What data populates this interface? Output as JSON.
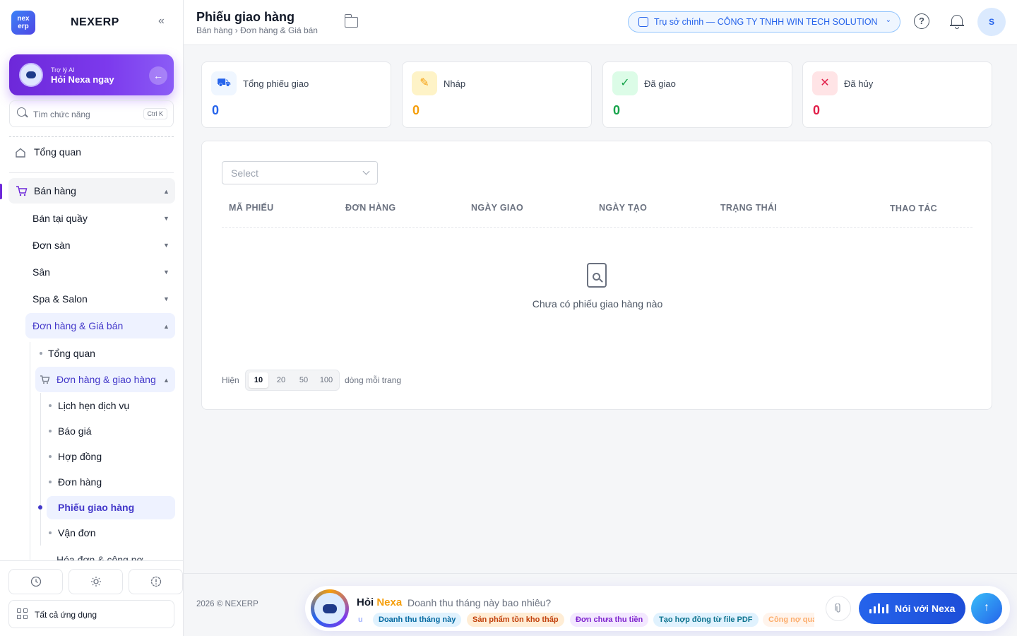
{
  "app": {
    "brand": "NEXERP",
    "logo_text": "nex erp",
    "collapse_icon": "«"
  },
  "ai_card": {
    "small": "Trợ lý AI",
    "title": "Hỏi Nexa ngay",
    "arrow": "←"
  },
  "search": {
    "placeholder": "Tìm chức năng",
    "shortcut": "Ctrl K"
  },
  "sidebar": {
    "overview": "Tổng quan",
    "sales": "Bán hàng",
    "items": [
      "Bán tại quầy",
      "Đơn sàn",
      "Sân",
      "Spa & Salon",
      "Đơn hàng & Giá bán"
    ],
    "sub_overview": "Tổng quan",
    "sub_group": "Đơn hàng & giao hàng",
    "leaves": [
      "Lịch hẹn dịch vụ",
      "Báo giá",
      "Hợp đồng",
      "Đơn hàng",
      "Phiếu giao hàng",
      "Vận đơn"
    ],
    "next_group": "Hóa đơn & công nợ",
    "all_apps": "Tất cả ứng dụng"
  },
  "header": {
    "title": "Phiếu giao hàng",
    "breadcrumb": "Bán hàng › Đơn hàng & Giá bán",
    "branch": "Trụ sở chính — CÔNG TY TNHH WIN TECH SOLUTION",
    "help": "?",
    "user_initial": "S"
  },
  "stats": [
    {
      "label": "Tổng phiếu giao",
      "value": "0",
      "color": "#2563eb",
      "bg": "#eff6ff",
      "icon": "truck-icon",
      "glyph": "⛟"
    },
    {
      "label": "Nháp",
      "value": "0",
      "color": "#f59e0b",
      "bg": "#fef3c7",
      "icon": "edit-icon",
      "glyph": "✎"
    },
    {
      "label": "Đã giao",
      "value": "0",
      "color": "#16a34a",
      "bg": "#dcfce7",
      "icon": "check-circle-icon",
      "glyph": "✓"
    },
    {
      "label": "Đã hủy",
      "value": "0",
      "color": "#e11d48",
      "bg": "#ffe4e6",
      "icon": "x-circle-icon",
      "glyph": "✕"
    }
  ],
  "filter": {
    "placeholder": "Select"
  },
  "table": {
    "columns": [
      "MÃ PHIẾU",
      "ĐƠN HÀNG",
      "NGÀY GIAO",
      "NGÀY TẠO",
      "TRẠNG THÁI",
      "THAO TÁC"
    ]
  },
  "empty": {
    "text": "Chưa có phiếu giao hàng nào"
  },
  "pagination": {
    "prefix": "Hiện",
    "options": [
      "10",
      "20",
      "50",
      "100"
    ],
    "selected": "10",
    "suffix": "dòng mỗi trang"
  },
  "footer": {
    "copyright": "2026 © NEXERP"
  },
  "ask": {
    "title_a": "Hỏi ",
    "title_b": "Nexa",
    "question": "Doanh thu tháng này bao nhiêu?",
    "chips": [
      "u",
      "Doanh thu tháng này",
      "Sản phẩm tồn kho thấp",
      "Đơn chưa thu tiền",
      "Tạo hợp đồng từ file PDF",
      "Công nợ quá hạn"
    ],
    "voice": "Nói với Nexa",
    "send": "↑"
  }
}
